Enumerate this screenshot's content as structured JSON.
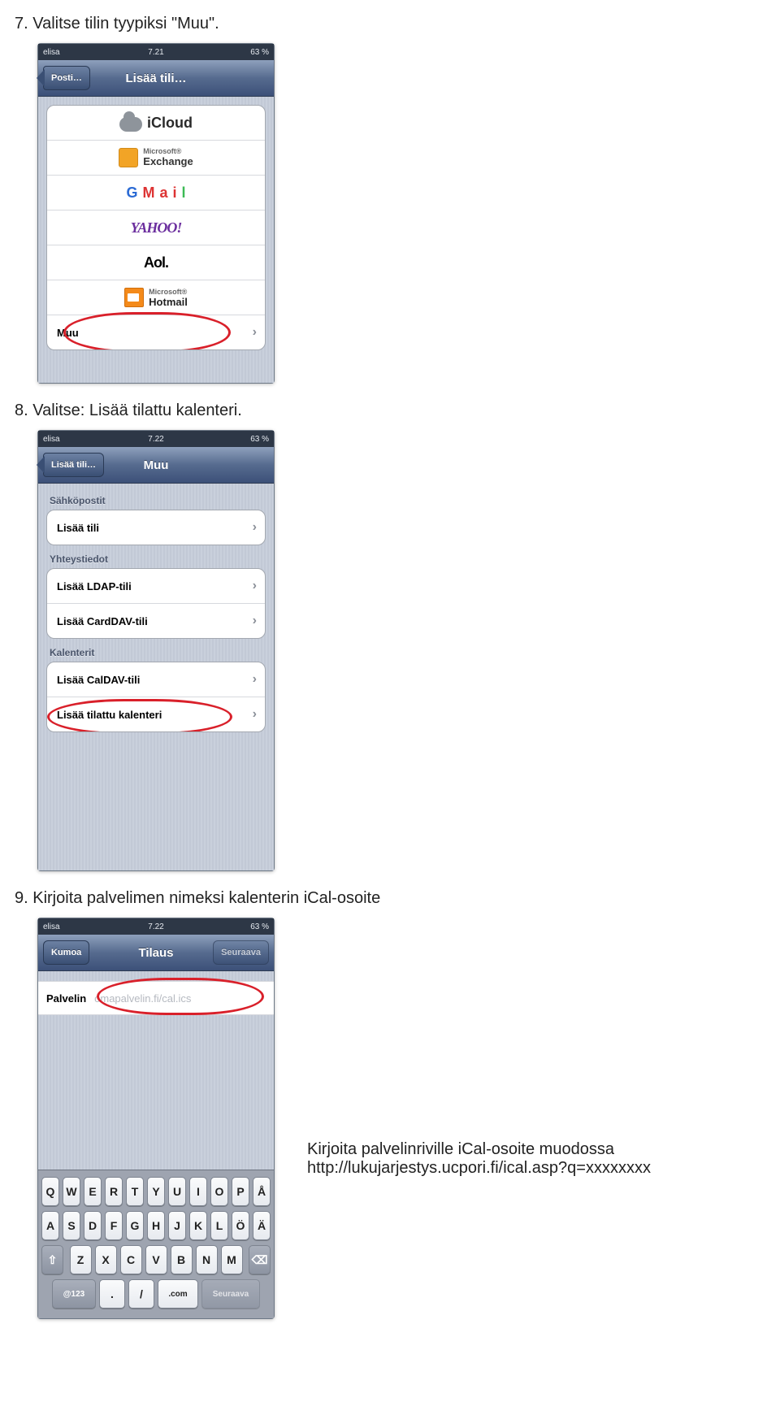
{
  "steps": {
    "s7": "7.  Valitse tilin tyypiksi \"Muu\".",
    "s8": "8.  Valitse: Lisää tilattu kalenteri.",
    "s9": "9.  Kirjoita palvelimen nimeksi kalenterin iCal-osoite"
  },
  "status": {
    "carrier": "elisa",
    "t1": "7.21",
    "t2": "7.22",
    "t3": "7.22",
    "battery": "63 %"
  },
  "phone1": {
    "back": "Posti…",
    "title": "Lisää tili…",
    "providers": {
      "icloud": "iCloud",
      "exchange_ms": "Microsoft®",
      "exchange": "Exchange",
      "gmail": "GMail",
      "yahoo": "YAHOO!",
      "aol": "Aol.",
      "hotmail_ms": "Microsoft®",
      "hotmail": "Hotmail",
      "muu": "Muu"
    }
  },
  "phone2": {
    "back": "Lisää tili…",
    "title": "Muu",
    "sections": {
      "sahkopostit": "Sähköpostit",
      "lisaa_tili": "Lisää tili",
      "yhteystiedot": "Yhteystiedot",
      "lisaa_ldap": "Lisää LDAP-tili",
      "lisaa_carddav": "Lisää CardDAV-tili",
      "kalenterit": "Kalenterit",
      "lisaa_caldav": "Lisää CalDAV-tili",
      "lisaa_tilattu": "Lisää tilattu kalenteri"
    }
  },
  "phone3": {
    "cancel": "Kumoa",
    "title": "Tilaus",
    "next": "Seuraava",
    "field_label": "Palvelin",
    "placeholder": "omapalvelin.fi/cal.ics"
  },
  "keyboard": {
    "r1": [
      "Q",
      "W",
      "E",
      "R",
      "T",
      "Y",
      "U",
      "I",
      "O",
      "P",
      "Å"
    ],
    "r2": [
      "A",
      "S",
      "D",
      "F",
      "G",
      "H",
      "J",
      "K",
      "L",
      "Ö",
      "Ä"
    ],
    "r3_shift": "⇧",
    "r3": [
      "Z",
      "X",
      "C",
      "V",
      "B",
      "N",
      "M"
    ],
    "r3_del": "⌫",
    "r4_123": "@123",
    "r4_dot": ".",
    "r4_slash": "/",
    "r4_com": ".com",
    "r4_next": "Seuraava"
  },
  "note": {
    "line1": "Kirjoita palvelinriville iCal-osoite muodossa",
    "line2": "http://lukujarjestys.ucpori.fi/ical.asp?q=xxxxxxxx"
  }
}
